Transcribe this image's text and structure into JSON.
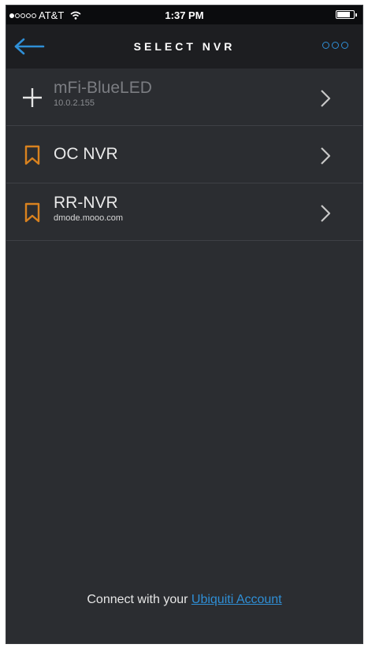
{
  "status_bar": {
    "carrier": "AT&T",
    "time": "1:37 PM",
    "signal_bars_on": 1,
    "signal_bars_total": 5
  },
  "nav": {
    "title": "SELECT NVR",
    "back_icon": "arrow-left-icon",
    "more_icon": "more-dots-icon",
    "accent_color": "#2f8fd6"
  },
  "nvr_items": [
    {
      "name": "mFi-BlueLED",
      "subtitle": "10.0.2.155",
      "icon": "plus-icon",
      "muted": true
    },
    {
      "name": "OC NVR",
      "subtitle": "",
      "icon": "bookmark-icon",
      "muted": false
    },
    {
      "name": "RR-NVR",
      "subtitle": "dmode.mooo.com",
      "icon": "bookmark-icon",
      "muted": false
    }
  ],
  "footer": {
    "prefix": "Connect with your",
    "link_text": "Ubiquiti Account"
  },
  "colors": {
    "background": "#2b2d31",
    "nav_background": "#1d1e21",
    "bookmark": "#d9821f",
    "link": "#2f8fd6"
  }
}
